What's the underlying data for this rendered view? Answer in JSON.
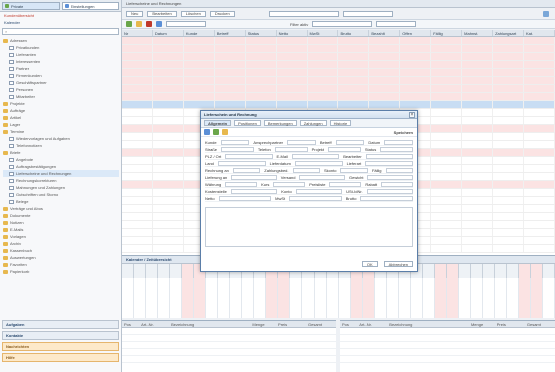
{
  "sidebar": {
    "tabs": [
      {
        "label": "Private"
      },
      {
        "label": "Einstellungen"
      }
    ],
    "links": [
      "Kundenübersicht",
      "Kalender"
    ],
    "tree": [
      {
        "label": "Adressen",
        "type": "folder",
        "indent": 0
      },
      {
        "label": "Privatkunden",
        "type": "doc",
        "indent": 1
      },
      {
        "label": "Lieferanten",
        "type": "doc",
        "indent": 1
      },
      {
        "label": "Interessenten",
        "type": "doc",
        "indent": 1
      },
      {
        "label": "Partner",
        "type": "doc",
        "indent": 1
      },
      {
        "label": "Firmenkunden",
        "type": "doc",
        "indent": 1
      },
      {
        "label": "Geschäftspartner",
        "type": "doc",
        "indent": 1
      },
      {
        "label": "Personen",
        "type": "doc",
        "indent": 1
      },
      {
        "label": "Mitarbeiter",
        "type": "doc",
        "indent": 1
      },
      {
        "label": "Projekte",
        "type": "folder",
        "indent": 0
      },
      {
        "label": "Aufträge",
        "type": "folder",
        "indent": 0
      },
      {
        "label": "Artikel",
        "type": "folder",
        "indent": 0
      },
      {
        "label": "Lager",
        "type": "folder",
        "indent": 0
      },
      {
        "label": "Termine",
        "type": "folder",
        "indent": 0
      },
      {
        "label": "Wiedervorlagen und Aufgaben",
        "type": "doc",
        "indent": 1
      },
      {
        "label": "Telefonnotizen",
        "type": "doc",
        "indent": 1
      },
      {
        "label": "Briefe",
        "type": "folder",
        "indent": 0
      },
      {
        "label": "Angebote",
        "type": "doc",
        "indent": 1
      },
      {
        "label": "Auftragsbestätigungen",
        "type": "doc",
        "indent": 1
      },
      {
        "label": "Lieferscheine und Rechnungen",
        "type": "doc",
        "indent": 1,
        "selected": true
      },
      {
        "label": "Rechnungskorrekturen",
        "type": "doc",
        "indent": 1
      },
      {
        "label": "Mahnungen und Zahlungen",
        "type": "doc",
        "indent": 1
      },
      {
        "label": "Gutschriften und Storno",
        "type": "doc",
        "indent": 1
      },
      {
        "label": "Belege",
        "type": "doc",
        "indent": 1
      },
      {
        "label": "Verträge und Abos",
        "type": "folder",
        "indent": 0
      },
      {
        "label": "Dokumente",
        "type": "folder",
        "indent": 0
      },
      {
        "label": "Notizen",
        "type": "folder",
        "indent": 0
      },
      {
        "label": "E-Mails",
        "type": "folder",
        "indent": 0
      },
      {
        "label": "Vorlagen",
        "type": "folder",
        "indent": 0
      },
      {
        "label": "Archiv",
        "type": "folder",
        "indent": 0
      },
      {
        "label": "Kassenbuch",
        "type": "folder",
        "indent": 0
      },
      {
        "label": "Auswertungen",
        "type": "folder",
        "indent": 0
      },
      {
        "label": "Favoriten",
        "type": "folder",
        "indent": 0
      },
      {
        "label": "Papierkorb",
        "type": "folder",
        "indent": 0
      }
    ],
    "bottom_sections": [
      "Aufgaben",
      "Kontakte",
      "Nachrichten",
      "Hilfe"
    ]
  },
  "main": {
    "window_title": "Lieferscheine und Rechnungen",
    "toolbar1": [
      "Neu",
      "Bearbeiten",
      "Löschen",
      "Drucken"
    ],
    "toolbar2_filter_label": "Filter aktiv",
    "grid_headers": [
      "Nr",
      "Datum",
      "Kunde",
      "Betreff",
      "Status",
      "Netto",
      "MwSt",
      "Brutto",
      "Bezahlt",
      "Offen",
      "Fällig",
      "Mahnst.",
      "Zahlungsart",
      "Kat."
    ],
    "grid_rows": [
      {
        "style": "pink",
        "cells": [
          "",
          "",
          "",
          "",
          "",
          "",
          "",
          "",
          "",
          "",
          "",
          "",
          "",
          ""
        ]
      },
      {
        "style": "pink",
        "cells": [
          "",
          "",
          "",
          "",
          "",
          "",
          "",
          "",
          "",
          "",
          "",
          "",
          "",
          ""
        ]
      },
      {
        "style": "pink",
        "cells": [
          "",
          "",
          "",
          "",
          "",
          "",
          "",
          "",
          "",
          "",
          "",
          "",
          "",
          ""
        ]
      },
      {
        "style": "pink",
        "cells": [
          "",
          "",
          "",
          "",
          "",
          "",
          "",
          "",
          "",
          "",
          "",
          "",
          "",
          ""
        ]
      },
      {
        "style": "pink",
        "cells": [
          "",
          "",
          "",
          "",
          "",
          "",
          "",
          "",
          "",
          "",
          "",
          "",
          "",
          ""
        ]
      },
      {
        "style": "pink",
        "cells": [
          "",
          "",
          "",
          "",
          "",
          "",
          "",
          "",
          "",
          "",
          "",
          "",
          "",
          ""
        ]
      },
      {
        "style": "pink",
        "cells": [
          "",
          "",
          "",
          "",
          "",
          "",
          "",
          "",
          "",
          "",
          "",
          "",
          "",
          ""
        ]
      },
      {
        "style": "pink",
        "cells": [
          "",
          "",
          "",
          "",
          "",
          "",
          "",
          "",
          "",
          "",
          "",
          "",
          "",
          ""
        ]
      },
      {
        "style": "sel",
        "cells": [
          "",
          "",
          "",
          "",
          "",
          "",
          "",
          "",
          "",
          "",
          "",
          "",
          "",
          ""
        ]
      },
      {
        "style": "",
        "cells": [
          "",
          "",
          "",
          "",
          "",
          "",
          "",
          "",
          "",
          "",
          "",
          "",
          "",
          ""
        ]
      },
      {
        "style": "",
        "cells": [
          "",
          "",
          "",
          "",
          "",
          "",
          "",
          "",
          "",
          "",
          "",
          "",
          "",
          ""
        ]
      },
      {
        "style": "pink",
        "cells": [
          "",
          "",
          "",
          "",
          "",
          "",
          "",
          "",
          "",
          "",
          "",
          "",
          "",
          ""
        ]
      },
      {
        "style": "",
        "cells": [
          "",
          "",
          "",
          "",
          "",
          "",
          "",
          "",
          "",
          "",
          "",
          "",
          "",
          ""
        ]
      },
      {
        "style": "",
        "cells": [
          "",
          "",
          "",
          "",
          "",
          "",
          "",
          "",
          "",
          "",
          "",
          "",
          "",
          ""
        ]
      },
      {
        "style": "pink",
        "cells": [
          "",
          "",
          "",
          "",
          "",
          "",
          "",
          "",
          "",
          "",
          "",
          "",
          "",
          ""
        ]
      },
      {
        "style": "",
        "cells": [
          "",
          "",
          "",
          "",
          "",
          "",
          "",
          "",
          "",
          "",
          "",
          "",
          "",
          ""
        ]
      },
      {
        "style": "",
        "cells": [
          "",
          "",
          "",
          "",
          "",
          "",
          "",
          "",
          "",
          "",
          "",
          "",
          "",
          ""
        ]
      },
      {
        "style": "",
        "cells": [
          "",
          "",
          "",
          "",
          "",
          "",
          "",
          "",
          "",
          "",
          "",
          "",
          "",
          ""
        ]
      },
      {
        "style": "pink",
        "cells": [
          "",
          "",
          "",
          "",
          "",
          "",
          "",
          "",
          "",
          "",
          "",
          "",
          "",
          ""
        ]
      },
      {
        "style": "",
        "cells": [
          "",
          "",
          "",
          "",
          "",
          "",
          "",
          "",
          "",
          "",
          "",
          "",
          "",
          ""
        ]
      },
      {
        "style": "",
        "cells": [
          "",
          "",
          "",
          "",
          "",
          "",
          "",
          "",
          "",
          "",
          "",
          "",
          "",
          ""
        ]
      },
      {
        "style": "",
        "cells": [
          "",
          "",
          "",
          "",
          "",
          "",
          "",
          "",
          "",
          "",
          "",
          "",
          "",
          ""
        ]
      },
      {
        "style": "",
        "cells": [
          "",
          "",
          "",
          "",
          "",
          "",
          "",
          "",
          "",
          "",
          "",
          "",
          "",
          ""
        ]
      },
      {
        "style": "",
        "cells": [
          "",
          "",
          "",
          "",
          "",
          "",
          "",
          "",
          "",
          "",
          "",
          "",
          "",
          ""
        ]
      },
      {
        "style": "",
        "cells": [
          "",
          "",
          "",
          "",
          "",
          "",
          "",
          "",
          "",
          "",
          "",
          "",
          "",
          ""
        ]
      },
      {
        "style": "",
        "cells": [
          "",
          "",
          "",
          "",
          "",
          "",
          "",
          "",
          "",
          "",
          "",
          "",
          "",
          ""
        ]
      },
      {
        "style": "",
        "cells": [
          "",
          "",
          "",
          "",
          "",
          "",
          "",
          "",
          "",
          "",
          "",
          "",
          "",
          ""
        ]
      }
    ],
    "lower_title": "Kalender / Zeitübersicht",
    "cal_cols": 36,
    "bottom_left": {
      "headers": [
        "Pos",
        "Art.-Nr.",
        "Bezeichnung",
        "Menge",
        "Preis",
        "Gesamt"
      ],
      "rows": [
        [
          "",
          "",
          "",
          "",
          "",
          ""
        ],
        [
          "",
          "",
          "",
          "",
          "",
          ""
        ],
        [
          "",
          "",
          "",
          "",
          "",
          ""
        ],
        [
          "",
          "",
          "",
          "",
          "",
          ""
        ],
        [
          "",
          "",
          "",
          "",
          "",
          ""
        ]
      ]
    },
    "bottom_right": {
      "headers": [
        "Pos",
        "Art.-Nr.",
        "Bezeichnung",
        "Menge",
        "Preis",
        "Gesamt"
      ],
      "rows": [
        [
          "",
          "",
          "",
          "",
          "",
          ""
        ],
        [
          "",
          "",
          "",
          "",
          "",
          ""
        ],
        [
          "",
          "",
          "",
          "",
          "",
          ""
        ],
        [
          "",
          "",
          "",
          "",
          "",
          ""
        ],
        [
          "",
          "",
          "",
          "",
          "",
          ""
        ]
      ]
    }
  },
  "dialog": {
    "title": "Lieferschein und Rechnung",
    "tabs": [
      "Allgemein",
      "Positionen",
      "Bemerkungen",
      "Zahlungen",
      "Historie"
    ],
    "tools_label": "Speichern",
    "rows": [
      [
        {
          "l": "Kunde"
        },
        {
          "l": "Ansprechpartner"
        },
        {
          "l": "Betreff"
        },
        {
          "l": "Datum"
        }
      ],
      [
        {
          "l": "Straße"
        },
        {
          "l": "Telefon"
        },
        {
          "l": "Projekt"
        },
        {
          "l": "Status"
        }
      ],
      [
        {
          "l": "PLZ / Ort"
        },
        {
          "l": "E-Mail"
        },
        {
          "l": "Bearbeiter"
        }
      ],
      [
        {
          "l": "Land"
        },
        {
          "l": "Lieferdatum"
        },
        {
          "l": "Lieferart"
        }
      ],
      [
        {
          "l": "Rechnung an"
        },
        {
          "l": "Zahlungsbed."
        },
        {
          "l": "Skonto"
        },
        {
          "l": "Fällig"
        }
      ],
      [
        {
          "l": "Lieferung an"
        },
        {
          "l": "Versand"
        },
        {
          "l": "Gewicht"
        }
      ],
      [
        {
          "l": "Währung"
        },
        {
          "l": "Kurs"
        },
        {
          "l": "Preisliste"
        },
        {
          "l": "Rabatt"
        }
      ],
      [
        {
          "l": "Kostenstelle"
        },
        {
          "l": "Konto"
        },
        {
          "l": "USt-IdNr."
        }
      ],
      [
        {
          "l": "Netto"
        },
        {
          "l": "MwSt"
        },
        {
          "l": "Brutto"
        }
      ]
    ],
    "footer": [
      "OK",
      "Abbrechen"
    ]
  },
  "colors": {
    "accent": "#2b4a6f",
    "weekend": "#fbe3e3",
    "selection": "#c8ddf3",
    "link": "#c0392b"
  }
}
